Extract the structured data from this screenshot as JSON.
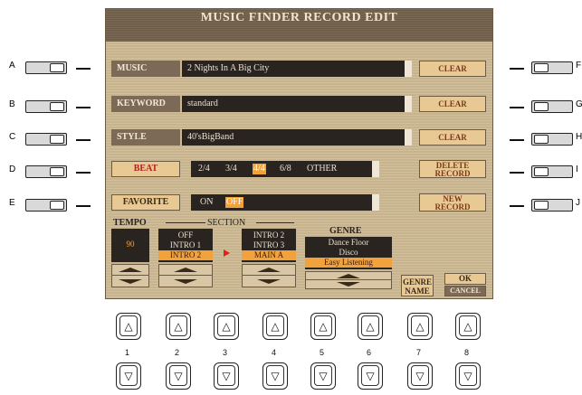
{
  "screen": {
    "title": "MUSIC FINDER RECORD EDIT",
    "rows": {
      "music": {
        "label": "MUSIC",
        "value": "2 Nights In A Big City",
        "action": "CLEAR"
      },
      "keyword": {
        "label": "KEYWORD",
        "value": "standard",
        "action": "CLEAR"
      },
      "style": {
        "label": "STYLE",
        "value": "40'sBigBand",
        "action": "CLEAR"
      }
    },
    "beat": {
      "label": "BEAT",
      "options": [
        "2/4",
        "3/4",
        "4/4",
        "6/8",
        "OTHER"
      ],
      "selected": "4/4"
    },
    "favorite": {
      "label": "FAVORITE",
      "options": [
        "ON",
        "OFF"
      ],
      "selected": "OFF"
    },
    "actions": {
      "delete_record_line1": "DELETE",
      "delete_record_line2": "RECORD",
      "new_record_line1": "NEW",
      "new_record_line2": "RECORD"
    },
    "tempo": {
      "label": "TEMPO",
      "value": "90"
    },
    "section": {
      "label": "SECTION",
      "left_list": [
        "OFF",
        "INTRO 1",
        "INTRO 2"
      ],
      "left_selected": "INTRO 2",
      "right_list": [
        "INTRO 2",
        "INTRO 3",
        "MAIN A"
      ],
      "right_selected": "MAIN A"
    },
    "genre": {
      "label": "GENRE",
      "list": [
        "Dance Floor",
        "Disco",
        "Easy Listening"
      ],
      "selected": "Easy Listening"
    },
    "genre_name_line1": "GENRE",
    "genre_name_line2": "NAME",
    "ok": "OK",
    "cancel": "CANCEL"
  },
  "side_buttons": {
    "left": [
      "A",
      "B",
      "C",
      "D",
      "E"
    ],
    "right": [
      "F",
      "G",
      "H",
      "I",
      "J"
    ]
  },
  "bottom_buttons": {
    "numbers": [
      "1",
      "2",
      "3",
      "4",
      "5",
      "6",
      "7",
      "8"
    ],
    "up_glyph": "△",
    "down_glyph": "▽"
  },
  "colors": {
    "screen_bg": "#c9b590",
    "label_bg": "#7c6a56",
    "value_bg": "#2a2420",
    "highlight": "#f2a23b",
    "button_face": "#e8c994",
    "beat_text": "#b02020"
  }
}
